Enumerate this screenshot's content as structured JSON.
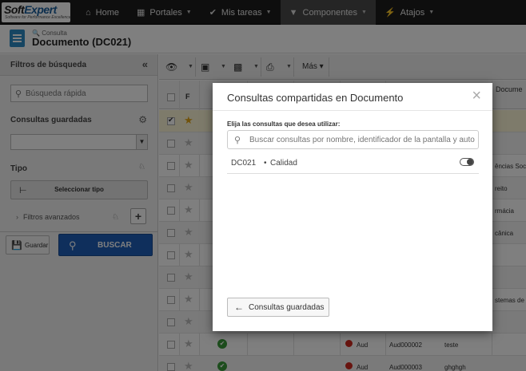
{
  "app": {
    "logo_text_1": "Soft",
    "logo_text_2": "Expert",
    "logo_tagline": "Software for Performance Excellence"
  },
  "nav": [
    {
      "label": "Home",
      "icon": "home-icon"
    },
    {
      "label": "Portales",
      "icon": "grid-icon"
    },
    {
      "label": "Mis tareas",
      "icon": "check-icon"
    },
    {
      "label": "Componentes",
      "icon": "component-icon",
      "active": true
    },
    {
      "label": "Atajos",
      "icon": "lightning-icon"
    }
  ],
  "header": {
    "breadcrumb": "Consulta",
    "title": "Documento (DC021)"
  },
  "filters": {
    "title": "Filtros de búsqueda",
    "quick_search_placeholder": "Búsqueda rápida",
    "saved_queries_label": "Consultas guardadas",
    "type_label": "Tipo",
    "select_type_label": "Seleccionar tipo",
    "advanced_label": "Filtros avanzados",
    "save_label": "Guardar",
    "search_label": "BUSCAR"
  },
  "toolbar": {
    "more_label": "Más"
  },
  "grid": {
    "col_f": "F",
    "col_doc": "Docume",
    "rows": [
      {
        "checked": true,
        "starred": true,
        "extra": ""
      },
      {
        "checked": false,
        "starred": false,
        "extra": ""
      },
      {
        "checked": false,
        "starred": false,
        "extra": "ências Soc"
      },
      {
        "checked": false,
        "starred": false,
        "extra": "reito"
      },
      {
        "checked": false,
        "starred": false,
        "extra": "rmácia"
      },
      {
        "checked": false,
        "starred": false,
        "extra": "cânica"
      },
      {
        "checked": false,
        "starred": false,
        "extra": ""
      },
      {
        "checked": false,
        "starred": false,
        "extra": ""
      },
      {
        "checked": false,
        "starred": false,
        "extra": "stemas de"
      },
      {
        "checked": false,
        "starred": false,
        "extra": ""
      },
      {
        "checked": false,
        "starred": false,
        "status": "Aud",
        "code": "Aud000002",
        "extra": "teste"
      },
      {
        "checked": false,
        "starred": false,
        "status": "Aud",
        "code": "Aud000003",
        "extra": "ghghgh"
      }
    ]
  },
  "modal": {
    "title": "Consultas compartidas en Documento",
    "instruction": "Elija las consultas que desea utilizar:",
    "search_placeholder": "Buscar consultas por nombre, identificador de la pantalla y autor",
    "items": [
      {
        "id": "DC021",
        "separator": "•",
        "name": "Calidad",
        "enabled": true
      }
    ],
    "back_label": "Consultas guardadas"
  }
}
